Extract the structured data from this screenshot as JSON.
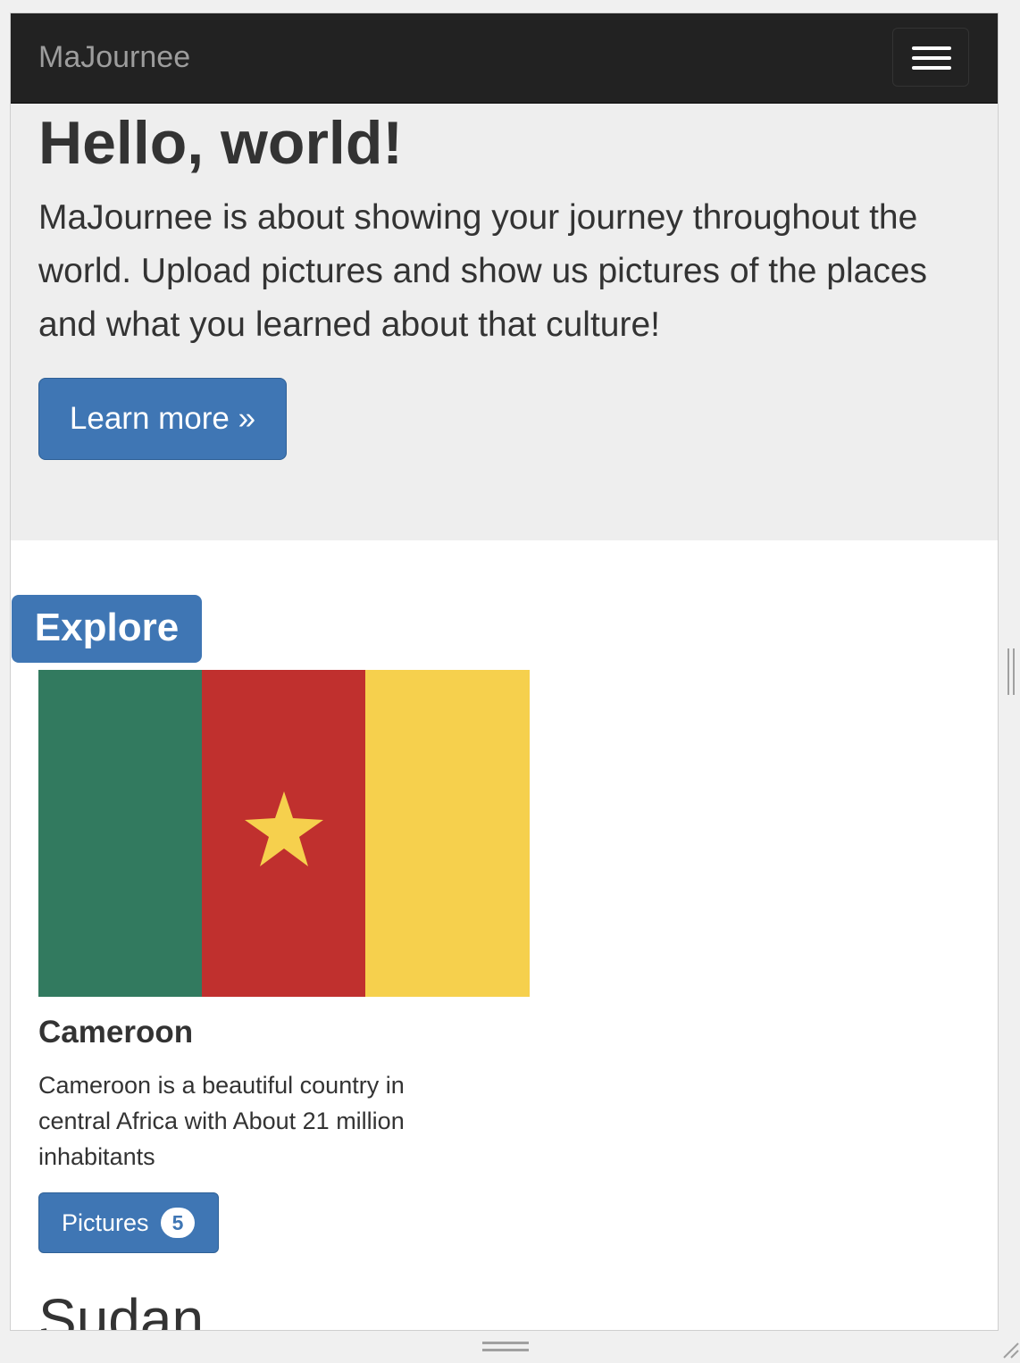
{
  "navbar": {
    "brand": "MaJournee",
    "menu_toggle_icon": "hamburger-icon"
  },
  "jumbotron": {
    "heading": "Hello, world!",
    "lead": "MaJournee is about showing your journey throughout the world. Upload pictures and show us pictures of the places and what you learned about that culture!",
    "learn_more_label": "Learn more »"
  },
  "explore": {
    "label": "Explore"
  },
  "countries": [
    {
      "name": "Cameroon",
      "flag_icon": "cameroon-flag-icon",
      "flag_colors": [
        "#327a5f",
        "#c0302e",
        "#f6d04d"
      ],
      "description": "Cameroon is a beautiful country in central Africa with About 21 million inhabitants",
      "pictures_label": "Pictures",
      "pictures_count": "5"
    },
    {
      "name": "Sudan"
    }
  ],
  "colors": {
    "navbar_bg": "#222222",
    "jumbotron_bg": "#eeeeee",
    "primary": "#3f76b4"
  }
}
